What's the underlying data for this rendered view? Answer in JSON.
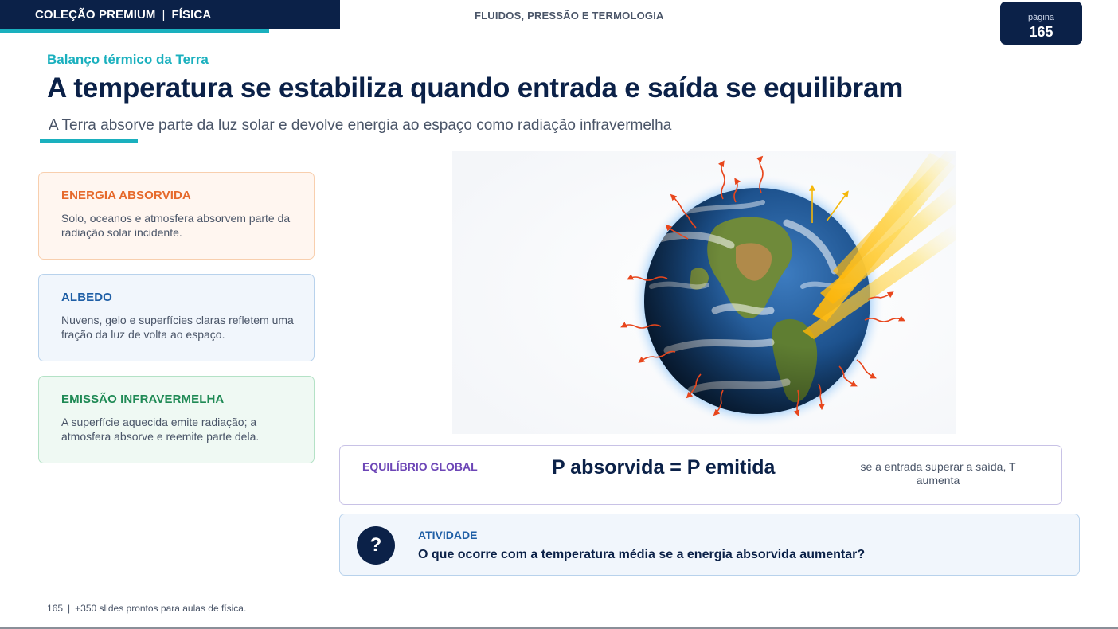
{
  "header": {
    "collection": "COLEÇÃO PREMIUM",
    "separator": "|",
    "subject": "FÍSICA",
    "chapter": "FLUIDOS, PRESSÃO E TERMOLOGIA",
    "page_label": "página",
    "page_number": "165"
  },
  "slide": {
    "kicker": "Balanço térmico da Terra",
    "title": "A temperatura se estabiliza quando entrada e saída se equilibram",
    "subtitle": "A Terra absorve parte da luz solar e devolve energia ao espaço como radiação infravermelha"
  },
  "cards": [
    {
      "title": "ENERGIA ABSORVIDA",
      "text": "Solo, oceanos e atmosfera absorvem parte da radiação solar incidente.",
      "accent": "#e66a2c"
    },
    {
      "title": "ALBEDO",
      "text": "Nuvens, gelo e superfícies claras refletem uma fração da luz de volta ao espaço.",
      "accent": "#1f5fa6"
    },
    {
      "title": "EMISSÃO INFRAVERMELHA",
      "text": "A superfície aquecida emite radiação; a atmosfera absorve e reemite parte dela.",
      "accent": "#1f8a55"
    }
  ],
  "illustration": {
    "subject": "earth-energy-balance-illustration",
    "colors": {
      "sunlight": "#f5b70a",
      "infrared": "#e8461c",
      "ocean": "#1b4f8a",
      "land": "#6f8a3a"
    }
  },
  "balance": {
    "label": "EQUILÍBRIO GLOBAL",
    "equation": "P absorvida = P emitida",
    "note": "se a entrada superar a saída, T aumenta"
  },
  "activity": {
    "icon_glyph": "?",
    "label": "ATIVIDADE",
    "question": "O que ocorre com a temperatura média se a energia absorvida aumentar?"
  },
  "footer": {
    "page": "165",
    "separator": "|",
    "text": "+350 slides prontos para aulas de física."
  }
}
